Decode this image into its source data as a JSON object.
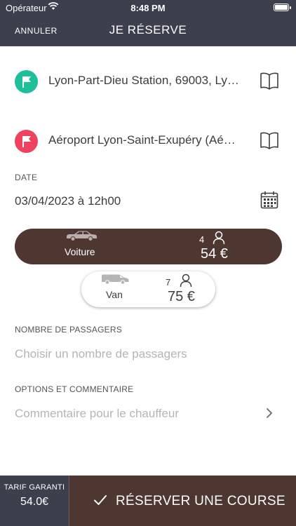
{
  "status_bar": {
    "carrier": "Opérateur",
    "time": "8:48 PM"
  },
  "nav": {
    "cancel_label": "ANNULER",
    "title": "JE RÉSERVE"
  },
  "pickup": {
    "address": "Lyon-Part-Dieu Station, 69003, Ly…",
    "pin_color": "#1fbf9c"
  },
  "dropoff": {
    "address": "Aéroport Lyon-Saint-Exupéry (Aé…",
    "pin_color": "#f0415f"
  },
  "date": {
    "label": "DATE",
    "value": "03/04/2023 à 12h00"
  },
  "vehicles": [
    {
      "name": "Voiture",
      "capacity": "4",
      "price": "54 €",
      "selected": true,
      "icon": "car-icon"
    },
    {
      "name": "Van",
      "capacity": "7",
      "price": "75 €",
      "selected": false,
      "icon": "van-icon"
    }
  ],
  "passengers": {
    "label": "NOMBRE DE PASSAGERS",
    "placeholder": "Choisir un nombre de passagers"
  },
  "options": {
    "label": "OPTIONS ET COMMENTAIRE",
    "placeholder": "Commentaire pour le chauffeur"
  },
  "footer": {
    "tariff_label": "TARIF GARANTI",
    "tariff_value": "54.0€",
    "reserve_label": "RÉSERVER UNE COURSE"
  },
  "colors": {
    "header_bg": "#3c3f4c",
    "accent_brown": "#4e3631",
    "pickup_green": "#1fbf9c",
    "dropoff_red": "#f0415f"
  }
}
